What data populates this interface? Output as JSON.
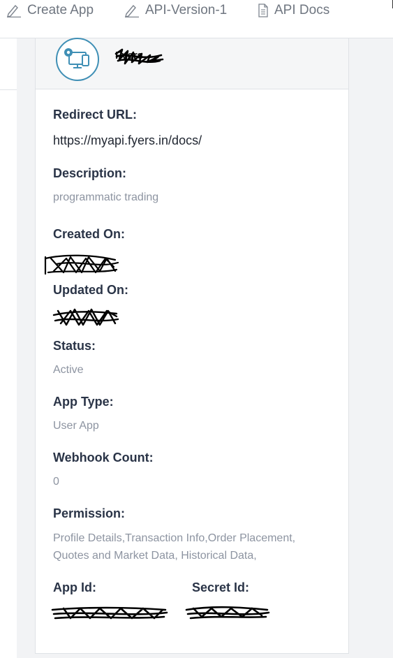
{
  "nav": {
    "create_app": "Create App",
    "api_version": "API-Version-1",
    "api_docs": "API Docs"
  },
  "app": {
    "name": "Fyers"
  },
  "fields": {
    "redirect_url": {
      "label": "Redirect URL:",
      "value": "https://myapi.fyers.in/docs/"
    },
    "description": {
      "label": "Description:",
      "value": "programmatic trading"
    },
    "created_on": {
      "label": "Created On:"
    },
    "updated_on": {
      "label": "Updated On:"
    },
    "status": {
      "label": "Status:",
      "value": "Active"
    },
    "app_type": {
      "label": "App Type:",
      "value": "User App"
    },
    "webhook_count": {
      "label": "Webhook Count:",
      "value": "0"
    },
    "permission": {
      "label": "Permission:",
      "value": "Profile Details,Transaction Info,Order Placement, Quotes and Market Data, Historical Data,"
    },
    "app_id": {
      "label": "App Id:"
    },
    "secret_id": {
      "label": "Secret Id:"
    }
  },
  "colors": {
    "icon_accent": "#3f8fb5",
    "label_text": "#2a3447",
    "muted_text": "#8d94a1"
  },
  "icons": [
    "pencil-icon",
    "pencil-icon",
    "document-icon",
    "app-settings-icon"
  ]
}
